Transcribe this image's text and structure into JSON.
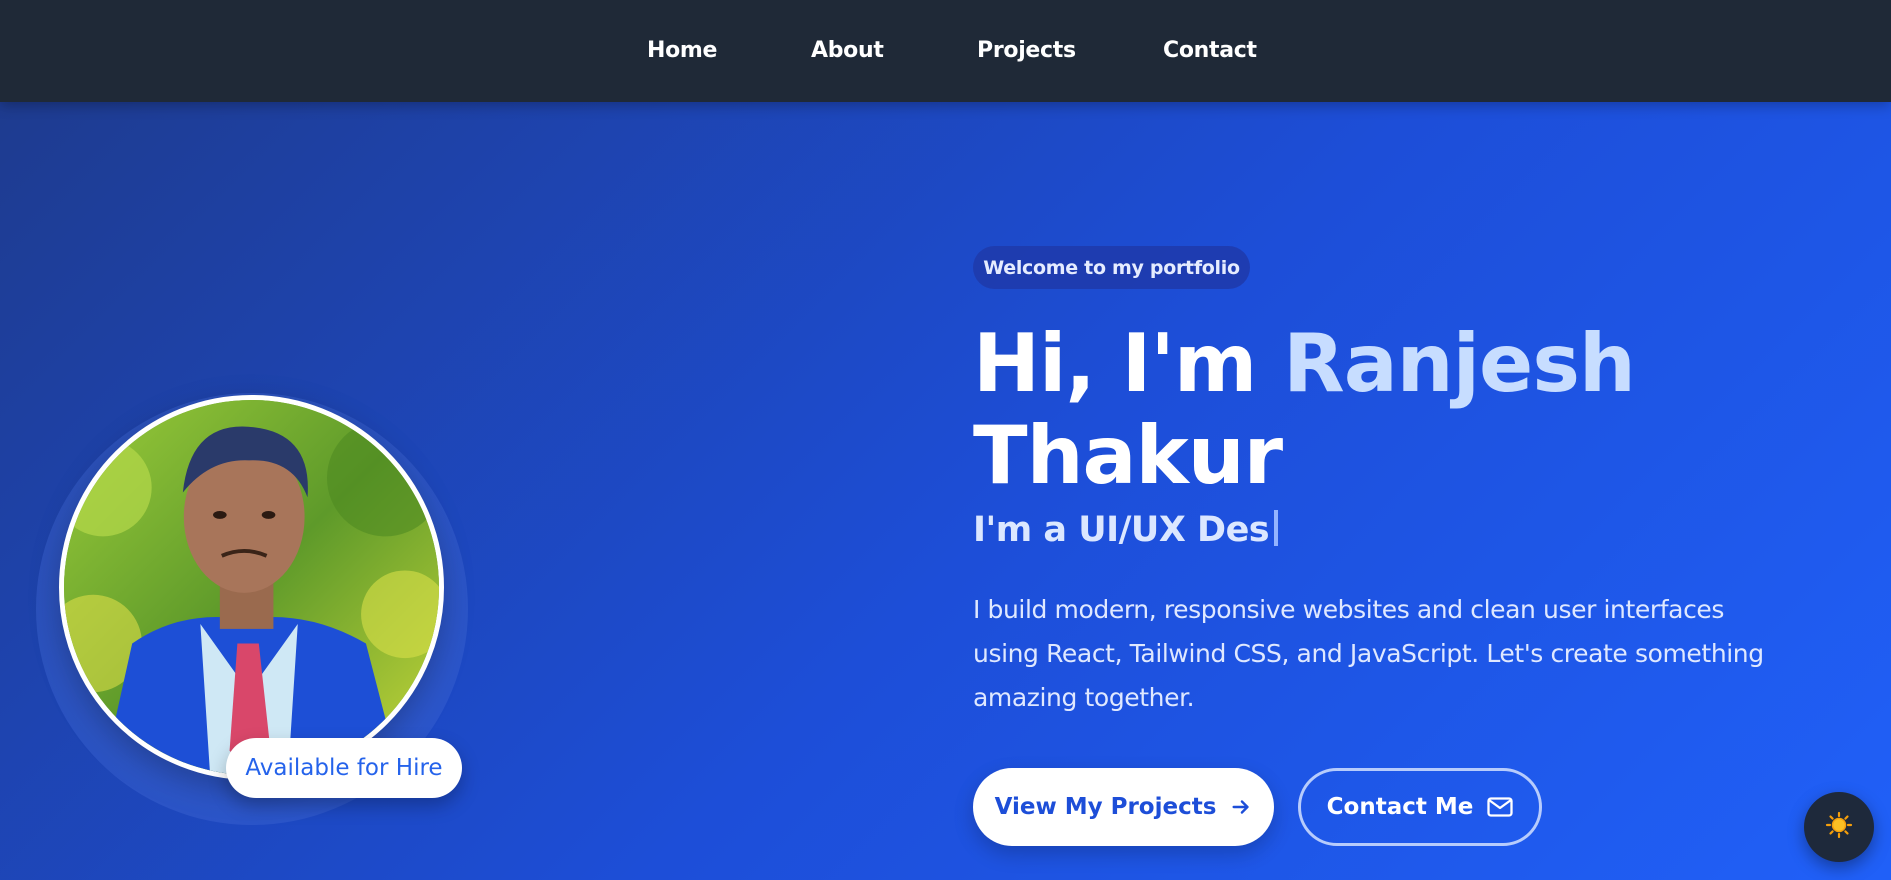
{
  "nav": {
    "items": [
      {
        "label": "Home"
      },
      {
        "label": "About"
      },
      {
        "label": "Projects"
      },
      {
        "label": "Contact"
      }
    ]
  },
  "profile": {
    "badge": "Available for Hire"
  },
  "hero": {
    "welcome": "Welcome to my portfolio",
    "greeting": "Hi, I'm",
    "first_name": "Ranjesh",
    "last_name": "Thakur",
    "typed_text": "I'm a UI/UX Des",
    "description": "I build modern, responsive websites and clean user interfaces using React, Tailwind CSS, and JavaScript. Let's create something amazing together.",
    "primary_button": "View My Projects",
    "secondary_button": "Contact Me"
  },
  "icons": {
    "primary_button_icon": "arrow-right-icon",
    "secondary_button_icon": "mail-icon",
    "theme_toggle_icon": "sun-icon"
  },
  "colors": {
    "navbar": "#1f2937",
    "hero_gradient_start": "#1e3a8a",
    "hero_gradient_end": "#2060f8",
    "name_highlight": "#c7ddff",
    "accent": "#2563eb",
    "sun": "#f59e0b"
  }
}
